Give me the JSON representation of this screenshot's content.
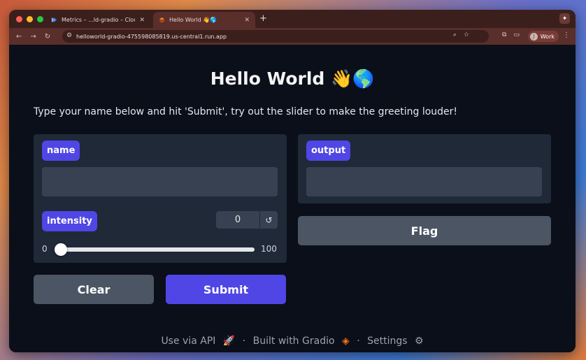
{
  "browser": {
    "tabs": [
      {
        "title": "Metrics – ...ld-gradio – Cloud",
        "active": false
      },
      {
        "title": "Hello World 👋🌎",
        "active": true
      }
    ],
    "url": "helloworld-gradio-475598085819.us-central1.run.app",
    "profile_label": "Work",
    "profile_initial": "J"
  },
  "app": {
    "title": "Hello World 👋🌎",
    "description": "Type your name below and hit 'Submit', try out the slider to make the greeting louder!",
    "inputs": {
      "name_label": "name",
      "name_value": "",
      "intensity_label": "intensity",
      "intensity_value": "0",
      "intensity_min": "0",
      "intensity_max": "100",
      "intensity_fraction": 0
    },
    "outputs": {
      "output_label": "output",
      "output_value": ""
    },
    "buttons": {
      "clear": "Clear",
      "submit": "Submit",
      "flag": "Flag"
    },
    "footer": {
      "api": "Use via API",
      "api_icon": "rocket-icon",
      "sep": "·",
      "built": "Built with Gradio",
      "built_icon": "gradio-logo-icon",
      "settings": "Settings",
      "settings_icon": "gear-icon"
    }
  },
  "colors": {
    "accent": "#4f46e5",
    "panel": "#1f2937",
    "input": "#374151",
    "background": "#0b0f19"
  }
}
